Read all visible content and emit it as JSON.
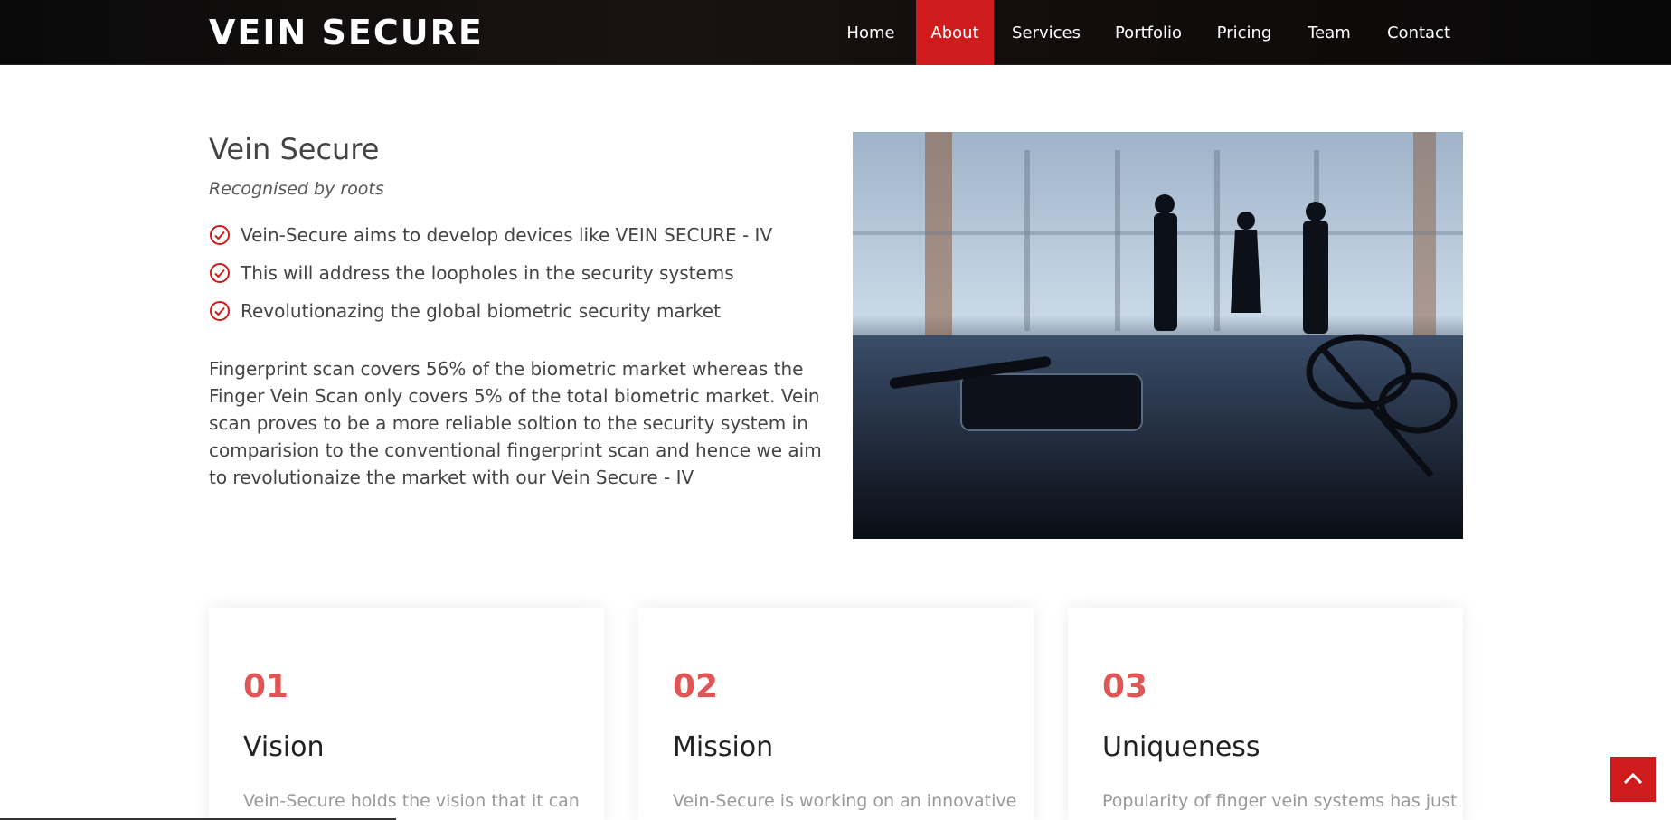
{
  "header": {
    "logo": "VEIN SECURE",
    "nav": [
      {
        "label": "Home",
        "active": false
      },
      {
        "label": "About",
        "active": true
      },
      {
        "label": "Services",
        "active": false
      },
      {
        "label": "Portfolio",
        "active": false
      },
      {
        "label": "Pricing",
        "active": false
      },
      {
        "label": "Team",
        "active": false
      },
      {
        "label": "Contact",
        "active": false
      }
    ]
  },
  "about": {
    "title": "Vein Secure",
    "tagline": "Recognised by roots",
    "checklist": [
      "Vein-Secure aims to develop devices like VEIN SECURE - IV",
      "This will address the loopholes in the security systems",
      "Revolutionazing the global biometric security market"
    ],
    "paragraph": "Fingerprint scan covers 56% of the biometric market whereas the Finger Vein Scan only covers 5% of the total biometric market. Vein scan proves to be a more reliable soltion to the security system in comparision to the conventional fingerprint scan and hence we aim to revolutionaize the market with our Vein Secure - IV"
  },
  "cards": [
    {
      "number": "01",
      "title": "Vision",
      "text": "Vein-Secure holds the vision that it can"
    },
    {
      "number": "02",
      "title": "Mission",
      "text": "Vein-Secure is working on an innovative"
    },
    {
      "number": "03",
      "title": "Uniqueness",
      "text": "Popularity of finger vein systems has just"
    }
  ],
  "colors": {
    "accent": "#cf1b1b",
    "card_number": "#e05555",
    "header_bg": "#0d0d0d"
  },
  "icons": {
    "check": "check-circle-icon",
    "back_to_top": "chevron-up-icon"
  }
}
